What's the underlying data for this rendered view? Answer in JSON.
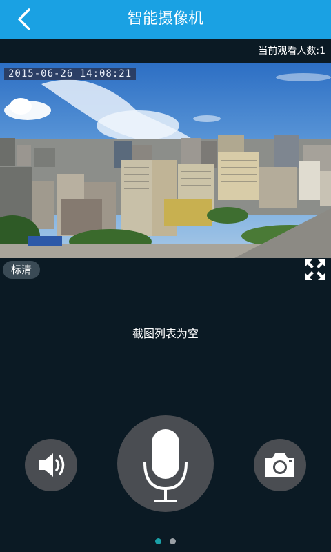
{
  "header": {
    "title": "智能摄像机",
    "back_icon": "chevron-left-icon"
  },
  "status": {
    "viewers_text": "当前观看人数:1"
  },
  "video": {
    "timestamp": "2015-06-26  14:08:21",
    "quality_label": "标清",
    "fullscreen_icon": "fullscreen-icon"
  },
  "screenshots": {
    "empty_text": "截图列表为空"
  },
  "controls": {
    "speaker_icon": "speaker-icon",
    "mic_icon": "microphone-icon",
    "camera_icon": "camera-icon"
  },
  "pager": {
    "total": 2,
    "active_index": 0
  },
  "colors": {
    "accent": "#1aa1e3",
    "background": "#0b1a24",
    "button": "#4a4d52",
    "dot_active": "#1aa1a8",
    "dot_inactive": "#9aa0a6"
  }
}
